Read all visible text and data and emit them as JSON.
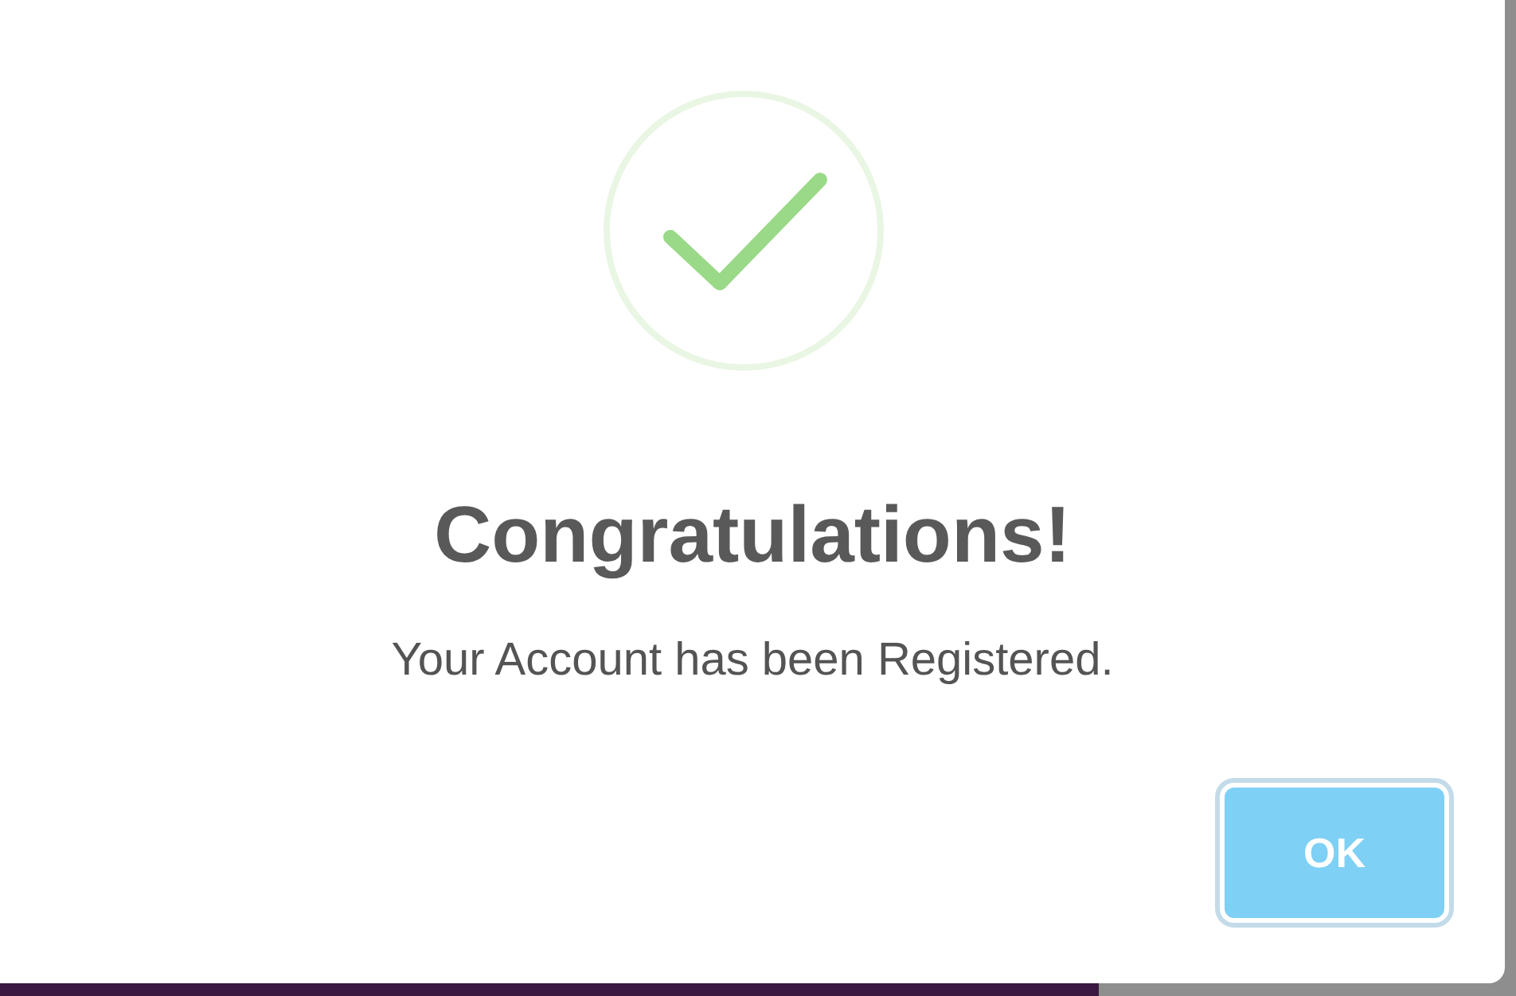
{
  "dialog": {
    "kind": "success",
    "title": "Congratulations!",
    "message": "Your Account has been Registered.",
    "button": "OK"
  }
}
